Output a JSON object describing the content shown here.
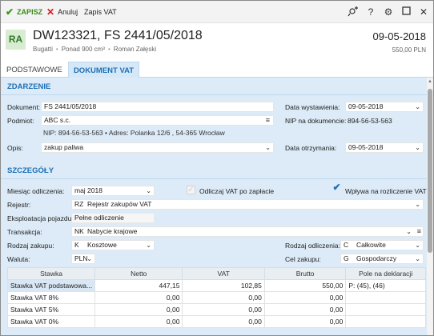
{
  "toolbar": {
    "save_label": "ZAPISZ",
    "cancel_label": "Anuluj",
    "vat_label": "Zapis VAT"
  },
  "header": {
    "avatar": "RA",
    "title": "DW123321, FS 2441/05/2018",
    "company": "Bugatti",
    "vehicle_class": "Ponad 900 cm³",
    "person": "Roman Załęski",
    "date": "09-05-2018",
    "amount": "550,00 PLN"
  },
  "tabs": {
    "basic": "PODSTAWOWE",
    "vat": "DOKUMENT VAT"
  },
  "event": {
    "section_title": "ZDARZENIE",
    "document_label": "Dokument:",
    "document_value": "FS 2441/05/2018",
    "subject_label": "Podmiot:",
    "subject_value": "ABC s.c.",
    "subject_details": "NIP: 894-56-53-563  •  Adres: Polanka 12/6 , 54-365 Wrocław",
    "description_label": "Opis:",
    "description_value": "zakup paliwa",
    "issue_date_label": "Data wystawienia:",
    "issue_date_value": "09-05-2018",
    "nip_label": "NIP na dokumencie:",
    "nip_value": "894-56-53-563",
    "receive_date_label": "Data otrzymania:",
    "receive_date_value": "09-05-2018"
  },
  "details": {
    "section_title": "SZCZEGÓŁY",
    "month_label": "Miesiąc odliczenia:",
    "month_value": "maj 2018",
    "deduct_after_payment_label": "Odliczaj VAT po zapłacie",
    "deduct_after_payment_checked": false,
    "affects_settlement_label": "Wpływa na rozliczenie VAT",
    "affects_settlement_checked": true,
    "register_label": "Rejestr:",
    "register_code": "RZ",
    "register_value": "Rejestr zakupów VAT",
    "usage_label": "Eksploatacja pojazdu:",
    "usage_value": "Pełne odliczenie",
    "transaction_label": "Transakcja:",
    "transaction_code": "NK",
    "transaction_value": "Nabycie krajowe",
    "purchase_type_label": "Rodzaj zakupu:",
    "purchase_type_code": "K",
    "purchase_type_value": "Kosztowe",
    "currency_label": "Waluta:",
    "currency_value": "PLN",
    "deduction_type_label": "Rodzaj odliczenia:",
    "deduction_type_code": "C",
    "deduction_type_value": "Całkowite",
    "purpose_label": "Cel zakupu:",
    "purpose_code": "G",
    "purpose_value": "Gospodarczy"
  },
  "vat_table": {
    "headers": [
      "Stawka",
      "Netto",
      "VAT",
      "Brutto",
      "Pole na deklaracji"
    ],
    "rows": [
      [
        "Stawka VAT podstawowa...",
        "447,15",
        "102,85",
        "550,00",
        "P: (45), (46)"
      ],
      [
        "Stawka VAT 8%",
        "0,00",
        "0,00",
        "0,00",
        ""
      ],
      [
        "Stawka VAT 5%",
        "0,00",
        "0,00",
        "0,00",
        ""
      ],
      [
        "Stawka VAT 0%",
        "0,00",
        "0,00",
        "0,00",
        ""
      ]
    ]
  },
  "icons": {
    "save": "check-icon",
    "cancel": "x-icon",
    "colors": {
      "accent": "#1d6fb5",
      "save": "#3a9a1c",
      "cancel": "#d21e1e",
      "panel": "#dcebf7"
    }
  }
}
